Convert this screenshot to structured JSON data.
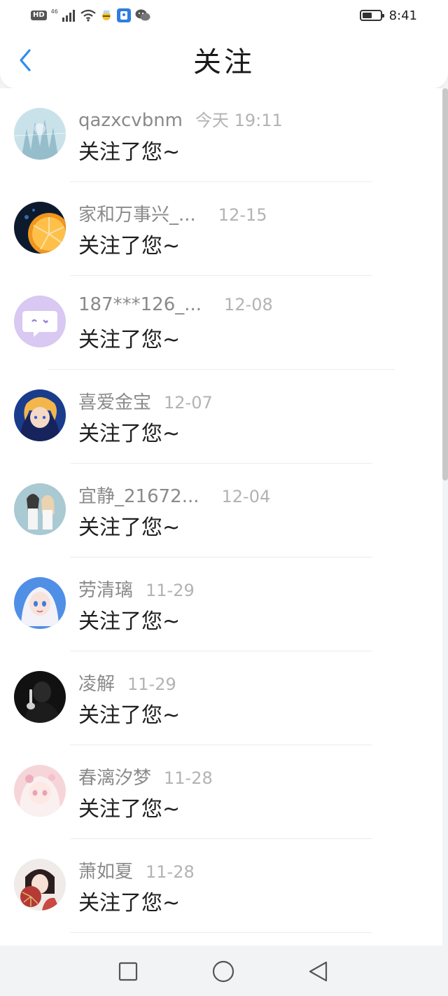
{
  "status_bar": {
    "hd": "HD",
    "network": "46",
    "time": "8:41",
    "battery_level": 0.55,
    "icons": [
      "signal-icon",
      "wifi-icon",
      "bee-app-icon",
      "security-app-icon",
      "wechat-icon"
    ]
  },
  "header": {
    "title": "关注",
    "back_icon": "chevron-left-icon",
    "accent": "#2f8cf0"
  },
  "notifications": [
    {
      "name": "qazxcvbnm",
      "time": "今天 19:11",
      "message": "关注了您~",
      "avatar": "ice-crystal-avatar",
      "colors": [
        "#c9e2ea",
        "#6b9fb0"
      ]
    },
    {
      "name": "家和万事兴_...",
      "time": "12-15",
      "message": "关注了您~",
      "avatar": "orange-slice-avatar",
      "colors": [
        "#0d1a2e",
        "#f0961e"
      ]
    },
    {
      "name": "187***126_...",
      "time": "12-08",
      "message": "关注了您~",
      "avatar": "chat-bubble-avatar",
      "colors": [
        "#d8c8f2",
        "#ffffff"
      ]
    },
    {
      "name": "喜爱金宝",
      "time": "12-07",
      "message": "关注了您~",
      "avatar": "anime-boy-avatar",
      "colors": [
        "#1a3c8c",
        "#f2b64a"
      ]
    },
    {
      "name": "宜静_21672...",
      "time": "12-04",
      "message": "关注了您~",
      "avatar": "two-girls-avatar",
      "colors": [
        "#a9c9d3",
        "#3a3a3a"
      ]
    },
    {
      "name": "劳清璃",
      "time": "11-29",
      "message": "关注了您~",
      "avatar": "princess-avatar",
      "colors": [
        "#4f8fe6",
        "#ffffff"
      ]
    },
    {
      "name": "凌解",
      "time": "11-29",
      "message": "关注了您~",
      "avatar": "dark-figure-avatar",
      "colors": [
        "#111111",
        "#555555"
      ]
    },
    {
      "name": "春漓汐梦",
      "time": "11-28",
      "message": "关注了您~",
      "avatar": "pink-girl-avatar",
      "colors": [
        "#f6d5d8",
        "#e8a3b6"
      ]
    },
    {
      "name": "萧如夏",
      "time": "11-28",
      "message": "关注了您~",
      "avatar": "fan-girl-avatar",
      "colors": [
        "#f0ebe8",
        "#b43a36"
      ]
    }
  ],
  "nav_bar": {
    "recent_icon": "square-icon",
    "home_icon": "circle-icon",
    "back_icon": "triangle-back-icon"
  }
}
